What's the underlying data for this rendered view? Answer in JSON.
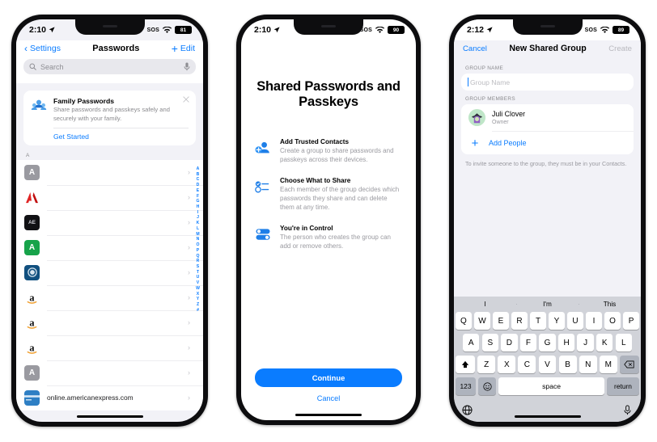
{
  "phone1": {
    "status": {
      "time": "2:10",
      "location_icon": "location-arrow-icon",
      "sos": "SOS",
      "wifi_icon": "wifi-icon",
      "battery": "81"
    },
    "nav": {
      "back_label": "Settings",
      "title": "Passwords",
      "add_label": "+",
      "edit_label": "Edit"
    },
    "search": {
      "placeholder": "Search",
      "icon": "search-icon",
      "mic_icon": "microphone-icon"
    },
    "promo": {
      "title": "Family Passwords",
      "subtitle": "Share passwords and passkeys safely and securely with your family.",
      "link": "Get Started",
      "close_icon": "close-icon",
      "icon": "family-group-icon"
    },
    "section_header": "A",
    "rows": [
      {
        "label": "",
        "icon": "gray-a-icon"
      },
      {
        "label": "",
        "icon": "adobe-icon"
      },
      {
        "label": "",
        "icon": "after-effects-icon"
      },
      {
        "label": "",
        "icon": "green-a-icon"
      },
      {
        "label": "",
        "icon": "blue-circle-icon"
      },
      {
        "label": "",
        "icon": "amazon-icon"
      },
      {
        "label": "",
        "icon": "amazon-icon"
      },
      {
        "label": "",
        "icon": "amazon-icon"
      },
      {
        "label": "",
        "icon": "gray-a-icon"
      },
      {
        "label": "online.americanexpress.com",
        "icon": "amex-card-icon"
      }
    ],
    "index_letters": [
      "A",
      "B",
      "C",
      "D",
      "E",
      "F",
      "G",
      "H",
      "I",
      "J",
      "K",
      "L",
      "M",
      "N",
      "O",
      "P",
      "Q",
      "R",
      "S",
      "T",
      "U",
      "V",
      "W",
      "X",
      "Y",
      "Z",
      "#"
    ]
  },
  "phone2": {
    "status": {
      "time": "2:10",
      "sos": "SOS",
      "battery": "90"
    },
    "title": "Shared Passwords and Passkeys",
    "features": [
      {
        "title": "Add Trusted Contacts",
        "desc": "Create a group to share passwords and passkeys across their devices.",
        "icon": "add-person-icon"
      },
      {
        "title": "Choose What to Share",
        "desc": "Each member of the group decides which passwords they share and can delete them at any time.",
        "icon": "checklist-icon"
      },
      {
        "title": "You're in Control",
        "desc": "The person who creates the group can add or remove others.",
        "icon": "toggles-icon"
      }
    ],
    "primary_button": "Continue",
    "secondary_button": "Cancel"
  },
  "phone3": {
    "status": {
      "time": "2:12",
      "sos": "SOS",
      "battery": "89"
    },
    "nav": {
      "cancel": "Cancel",
      "title": "New Shared Group",
      "create": "Create"
    },
    "group_name": {
      "header": "GROUP NAME",
      "placeholder": "Group Name",
      "value": ""
    },
    "members": {
      "header": "GROUP MEMBERS",
      "list": [
        {
          "name": "Juli Clover",
          "role": "Owner",
          "avatar": "witch-avatar"
        }
      ],
      "add_label": "Add People",
      "add_icon": "plus-icon"
    },
    "note": "To invite someone to the group, they must be in your Contacts.",
    "keyboard": {
      "predictions": [
        "I",
        "I'm",
        "This"
      ],
      "row1": [
        "Q",
        "W",
        "E",
        "R",
        "T",
        "Y",
        "U",
        "I",
        "O",
        "P"
      ],
      "row2": [
        "A",
        "S",
        "D",
        "F",
        "G",
        "H",
        "J",
        "K",
        "L"
      ],
      "row3": [
        "Z",
        "X",
        "C",
        "V",
        "B",
        "N",
        "M"
      ],
      "shift_icon": "shift-icon",
      "backspace_icon": "backspace-icon",
      "numbers_key": "123",
      "emoji_icon": "emoji-icon",
      "space_key": "space",
      "return_key": "return",
      "globe_icon": "globe-icon",
      "dictation_icon": "microphone-icon"
    }
  },
  "colors": {
    "accent": "#0a7cff",
    "background": "#ffffff",
    "group_bg": "#f2f2f7",
    "keyboard_bg": "#d1d3d9"
  }
}
